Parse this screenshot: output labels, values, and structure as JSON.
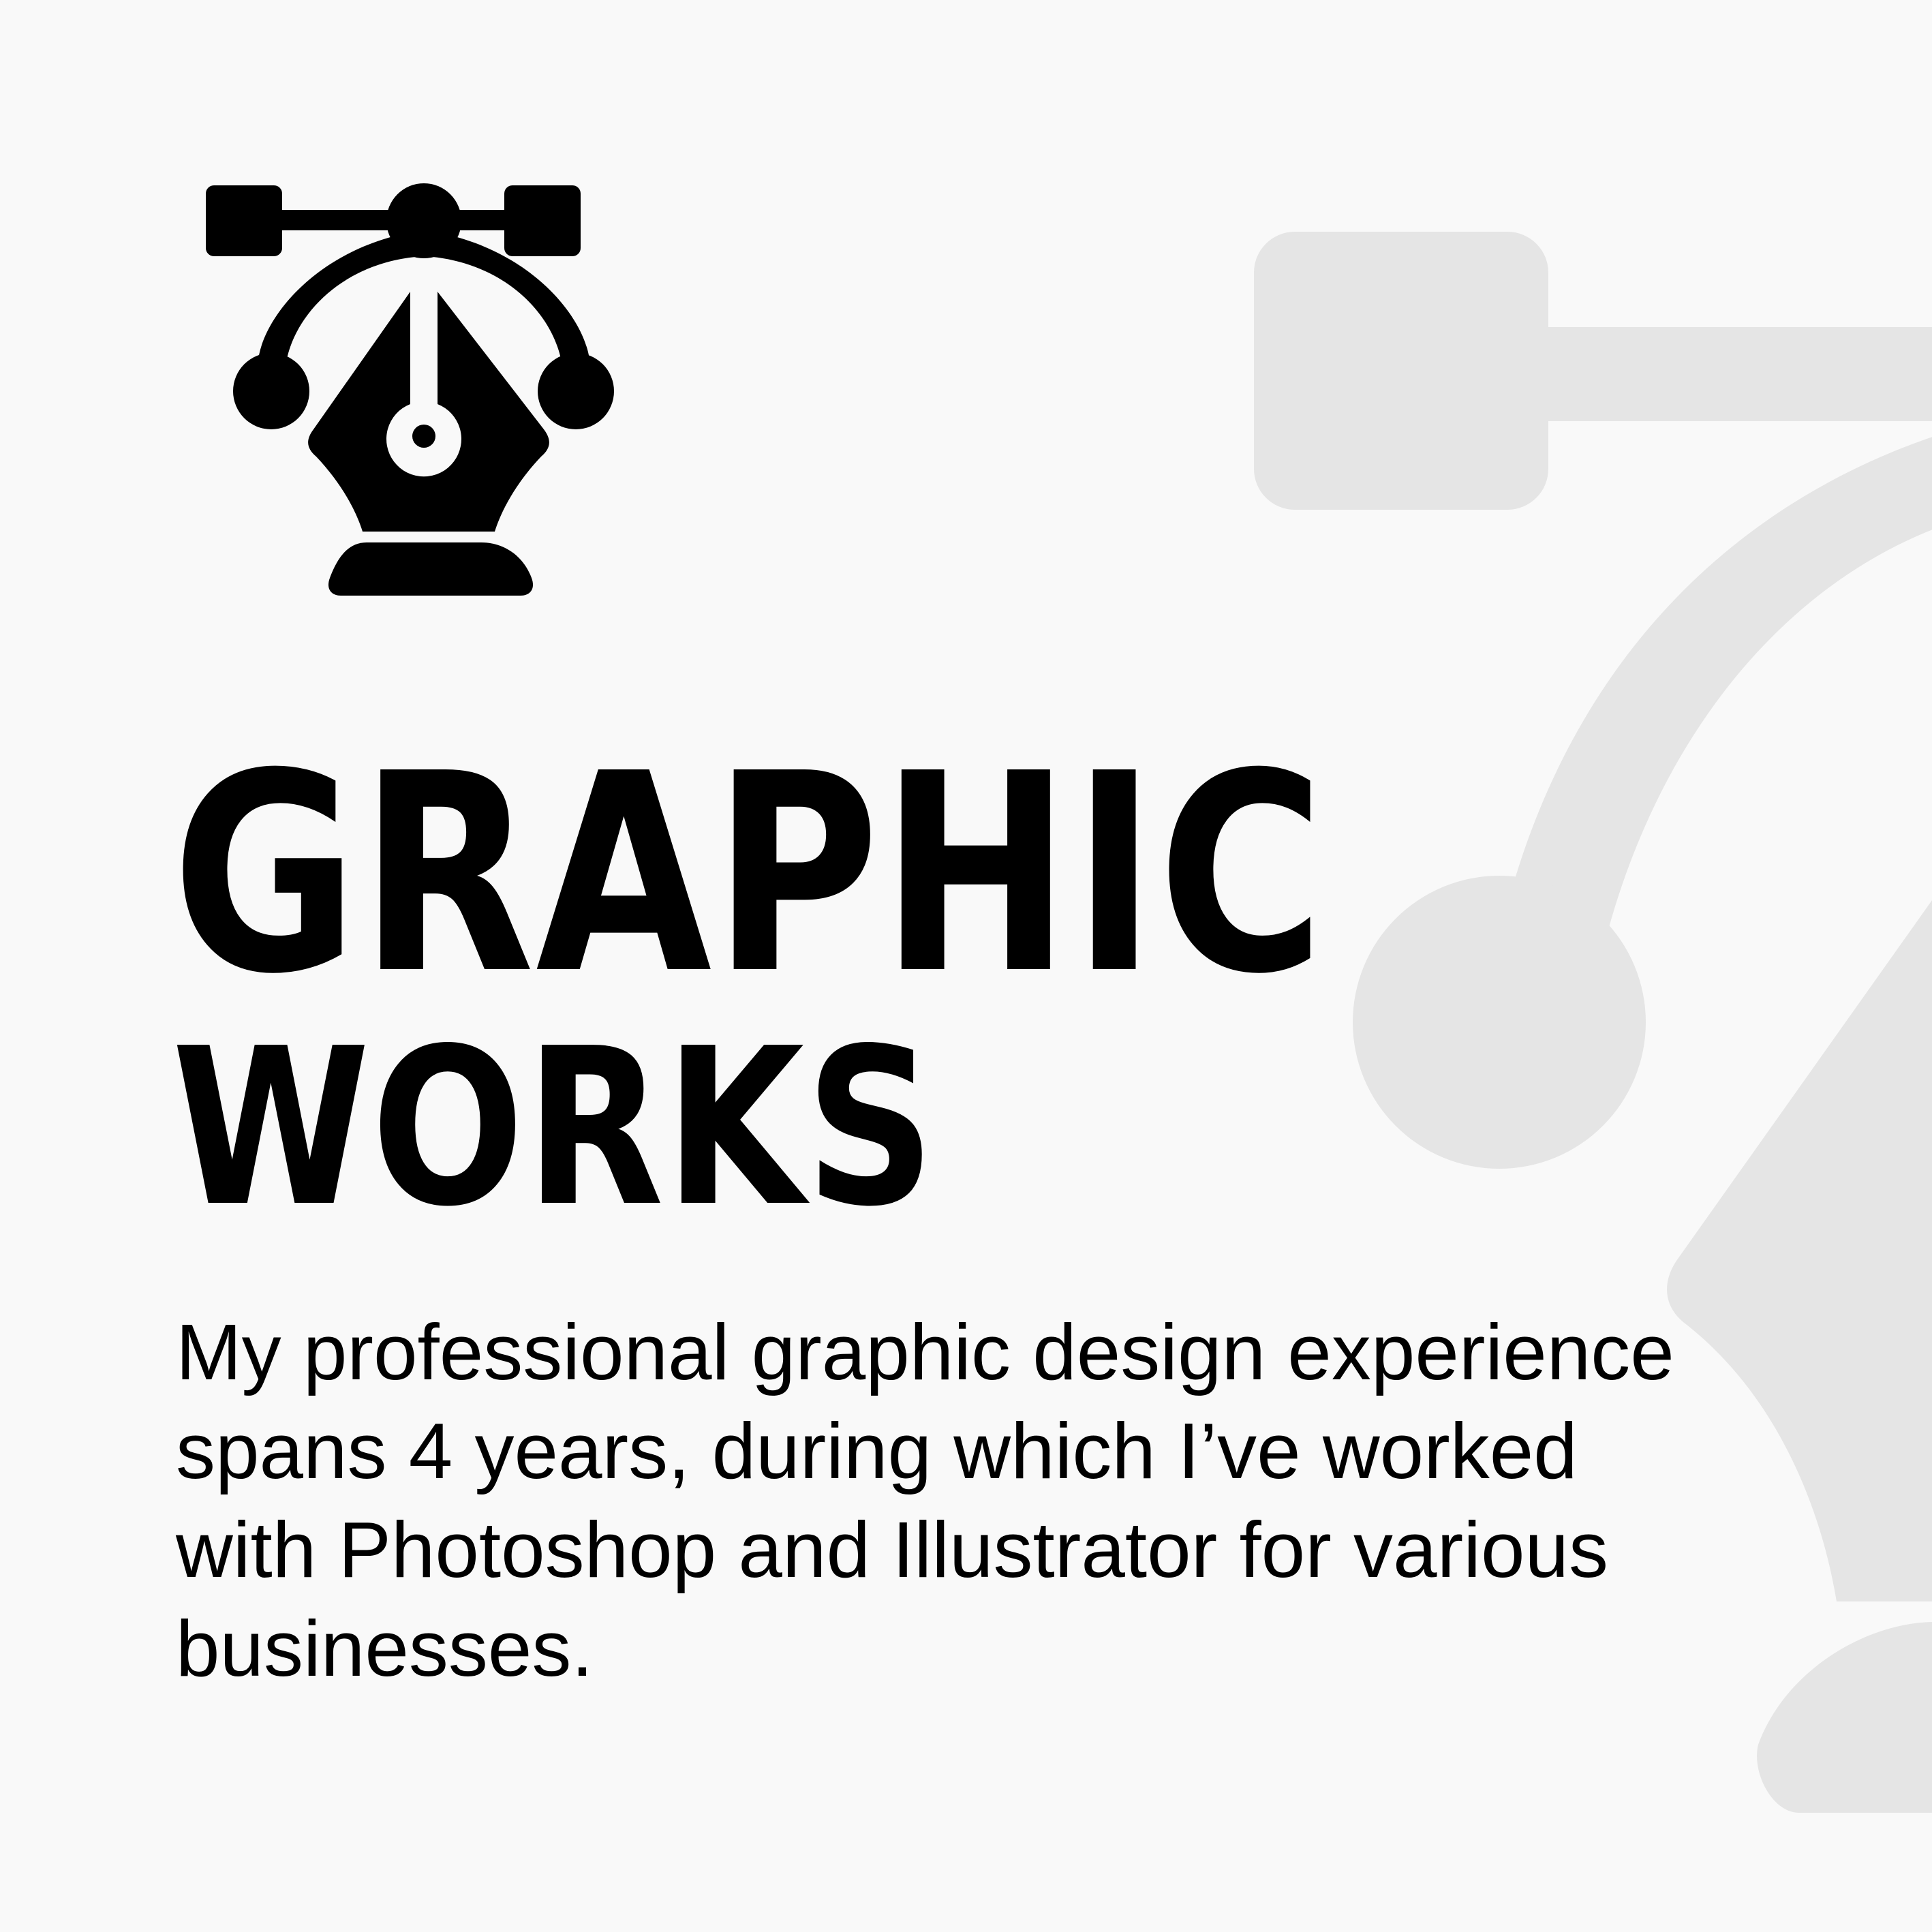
{
  "colors": {
    "background": "#f9f9f9",
    "foreground": "#000000",
    "watermark": "#e5e5e5"
  },
  "header": {
    "icon": "pen-tool-bezier-icon",
    "title_line_1": "GRAPHIC",
    "title_line_2": "WORKS"
  },
  "description": {
    "lines": [
      "My professional graphic design experience",
      "spans 4 years, during which I’ve worked",
      "with Photoshop and Illustrator for various",
      "businesses."
    ]
  },
  "background": {
    "icon": "pen-tool-bezier-watermark-icon"
  }
}
